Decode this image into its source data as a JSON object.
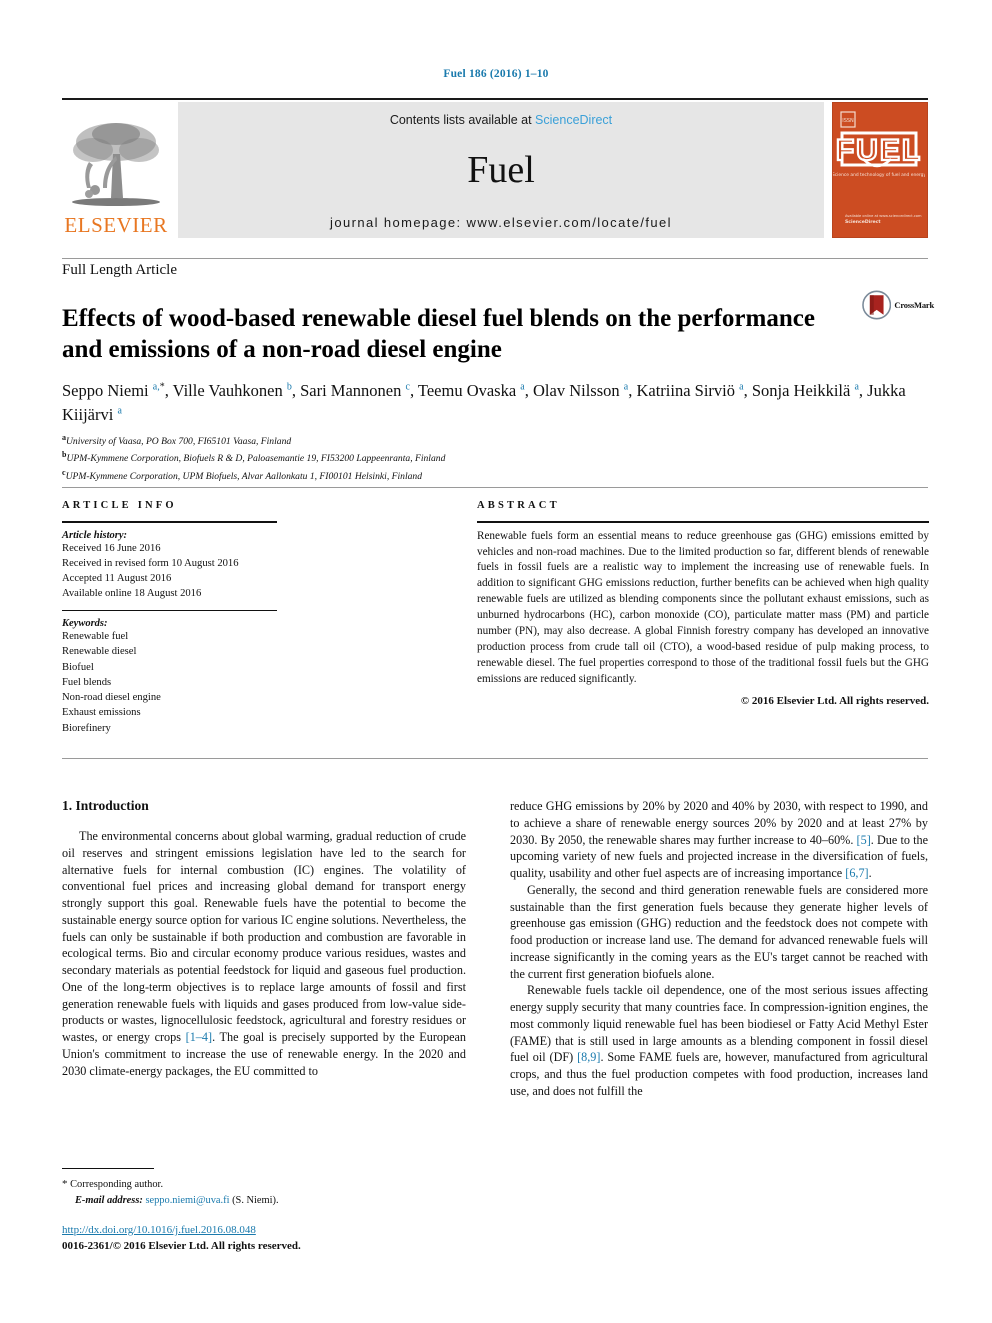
{
  "running_head": "Fuel 186 (2016) 1–10",
  "masthead": {
    "publisher_name": "ELSEVIER",
    "contents_prefix": "Contents lists available at ",
    "contents_link": "ScienceDirect",
    "journal_title": "Fuel",
    "homepage": "journal homepage: www.elsevier.com/locate/fuel",
    "cover_title": "FUEL",
    "cover_subtitle": "Science and technology of fuel and energy"
  },
  "article": {
    "type": "Full Length Article",
    "title": "Effects of wood-based renewable diesel fuel blends on the performance and emissions of a non-road diesel engine",
    "crossmark_label": "CrossMark",
    "authors_html": "Seppo Niemi <sup>a,</sup><sup class=\"star\">*</sup>, Ville Vauhkonen <sup>b</sup>, Sari Mannonen <sup>c</sup>, Teemu Ovaska <sup>a</sup>, Olav Nilsson <sup>a</sup>, Katriina Sirviö <sup>a</sup>, Sonja Heikkilä <sup>a</sup>, Jukka Kiijärvi <sup>a</sup>",
    "affiliations": [
      {
        "marker": "a",
        "text": "University of Vaasa, PO Box 700, FI65101 Vaasa, Finland"
      },
      {
        "marker": "b",
        "text": "UPM-Kymmene Corporation, Biofuels R & D, Paloasemantie 19, FI53200 Lappeenranta, Finland"
      },
      {
        "marker": "c",
        "text": "UPM-Kymmene Corporation, UPM Biofuels, Alvar Aallonkatu 1, FI00101 Helsinki, Finland"
      }
    ]
  },
  "article_info": {
    "heading": "ARTICLE INFO",
    "history_label": "Article history:",
    "history": [
      "Received 16 June 2016",
      "Received in revised form 10 August 2016",
      "Accepted 11 August 2016",
      "Available online 18 August 2016"
    ],
    "keywords_label": "Keywords:",
    "keywords": [
      "Renewable fuel",
      "Renewable diesel",
      "Biofuel",
      "Fuel blends",
      "Non-road diesel engine",
      "Exhaust emissions",
      "Biorefinery"
    ]
  },
  "abstract": {
    "heading": "ABSTRACT",
    "text": "Renewable fuels form an essential means to reduce greenhouse gas (GHG) emissions emitted by vehicles and non-road machines. Due to the limited production so far, different blends of renewable fuels in fossil fuels are a realistic way to implement the increasing use of renewable fuels. In addition to significant GHG emissions reduction, further benefits can be achieved when high quality renewable fuels are utilized as blending components since the pollutant exhaust emissions, such as unburned hydrocarbons (HC), carbon monoxide (CO), particulate matter mass (PM) and particle number (PN), may also decrease. A global Finnish forestry company has developed an innovative production process from crude tall oil (CTO), a wood-based residue of pulp making process, to renewable diesel. The fuel properties correspond to those of the traditional fossil fuels but the GHG emissions are reduced significantly.",
    "copyright": "© 2016 Elsevier Ltd. All rights reserved."
  },
  "body": {
    "section_heading": "1. Introduction",
    "left_paragraphs": [
      "The environmental concerns about global warming, gradual reduction of crude oil reserves and stringent emissions legislation have led to the search for alternative fuels for internal combustion (IC) engines. The volatility of conventional fuel prices and increasing global demand for transport energy strongly support this goal. Renewable fuels have the potential to become the sustainable energy source option for various IC engine solutions. Nevertheless, the fuels can only be sustainable if both production and combustion are favorable in ecological terms. Bio and circular economy produce various residues, wastes and secondary materials as potential feedstock for liquid and gaseous fuel production. One of the long-term objectives is to replace large amounts of fossil and first generation renewable fuels with liquids and gases produced from low-value side-products or wastes, lignocellulosic feedstock, agricultural and forestry residues or wastes, or energy crops [1–4]. The goal is precisely supported by the European Union's commitment to increase the use of renewable energy. In the 2020 and 2030 climate-energy packages, the EU committed to"
    ],
    "right_paragraphs": [
      "reduce GHG emissions by 20% by 2020 and 40% by 2030, with respect to 1990, and to achieve a share of renewable energy sources 20% by 2020 and at least 27% by 2030. By 2050, the renewable shares may further increase to 40–60%. [5]. Due to the upcoming variety of new fuels and projected increase in the diversification of fuels, quality, usability and other fuel aspects are of increasing importance [6,7].",
      "Generally, the second and third generation renewable fuels are considered more sustainable than the first generation fuels because they generate higher levels of greenhouse gas emission (GHG) reduction and the feedstock does not compete with food production or increase land use. The demand for advanced renewable fuels will increase significantly in the coming years as the EU's target cannot be reached with the current first generation biofuels alone.",
      "Renewable fuels tackle oil dependence, one of the most serious issues affecting energy supply security that many countries face. In compression-ignition engines, the most commonly liquid renewable fuel has been biodiesel or Fatty Acid Methyl Ester (FAME) that is still used in large amounts as a blending component in fossil diesel fuel oil (DF) [8,9]. Some FAME fuels are, however, manufactured from agricultural crops, and thus the fuel production competes with food production, increases land use, and does not fulfill the"
    ],
    "reference_tokens": [
      "[1–4]",
      "[5]",
      "[6,7]",
      "[8,9]"
    ]
  },
  "footnote": {
    "star": "*",
    "corresponding": "Corresponding author.",
    "email_label": "E-mail address:",
    "email": "seppo.niemi@uva.fi",
    "email_suffix": "(S. Niemi)."
  },
  "footer": {
    "doi": "http://dx.doi.org/10.1016/j.fuel.2016.08.048",
    "issn": "0016-2361/© 2016 Elsevier Ltd. All rights reserved."
  },
  "colors": {
    "link_blue": "#1a7aad",
    "sciencedirect_blue": "#3aa0d8",
    "elsevier_orange": "#E87722",
    "cover_orange": "#CC4C22"
  }
}
